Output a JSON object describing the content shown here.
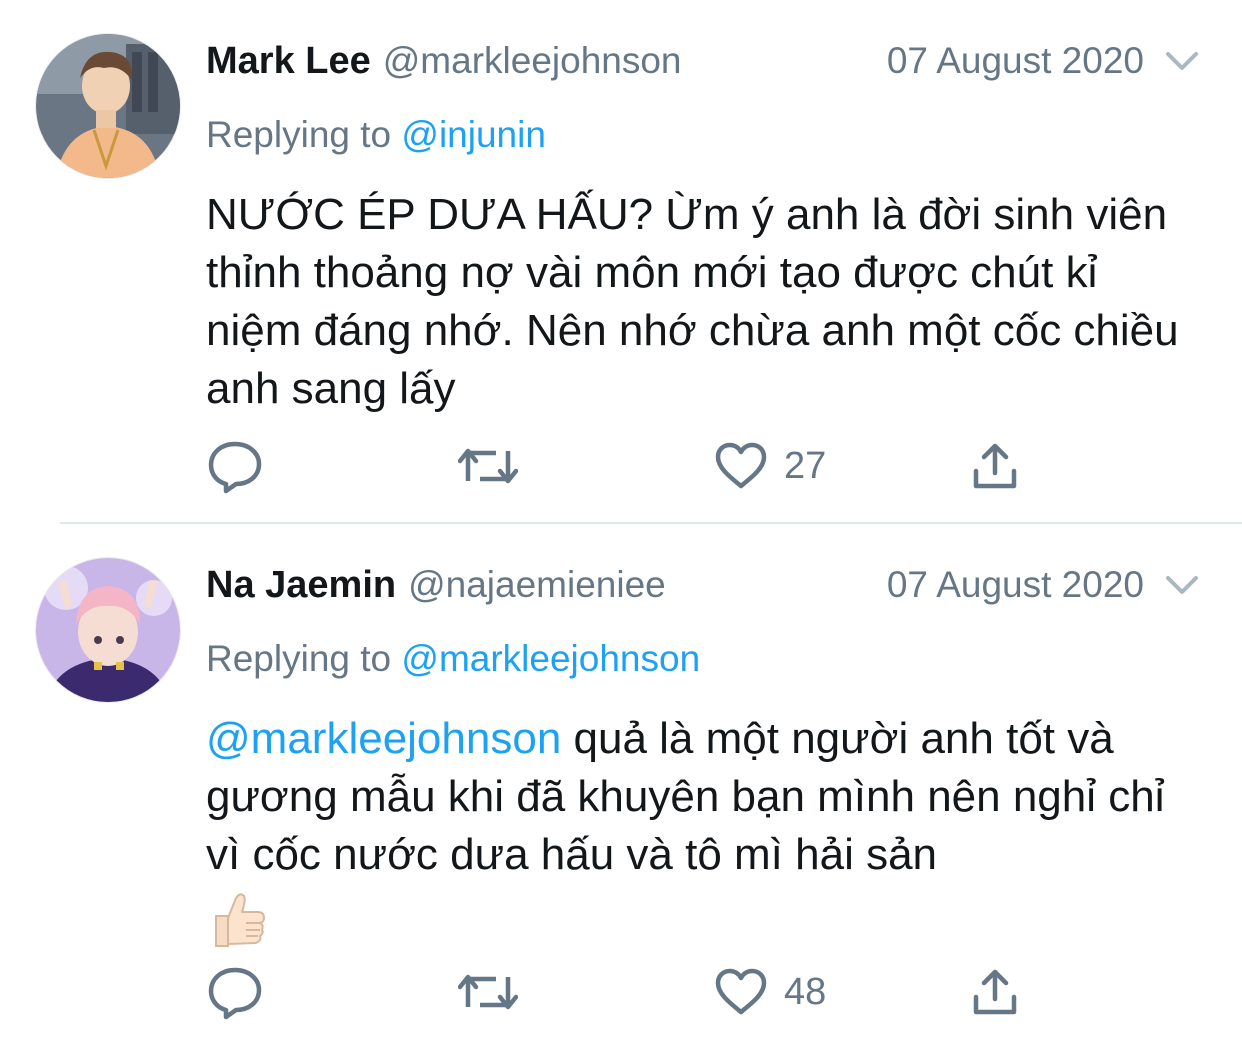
{
  "colors": {
    "link": "#1da1f2",
    "secondary_text": "#657786",
    "primary_text": "#14171a",
    "divider": "#e1e8ed"
  },
  "tweets": [
    {
      "author_name": "Mark Lee",
      "handle": "@markleejohnson",
      "date": "07 August 2020",
      "replying_prefix": "Replying to",
      "replying_to": "@injunin",
      "body": "NƯỚC ÉP DƯA HẤU? Ừm ý anh là đời sinh viên thỉnh thoảng nợ vài môn mới tạo được chút kỉ niệm đáng nhớ. Nên nhớ chừa anh một cốc chiều anh sang lấy",
      "like_count": "27",
      "icons": [
        "reply-icon",
        "retweet-icon",
        "like-icon",
        "share-icon"
      ]
    },
    {
      "author_name": "Na Jaemin",
      "handle": "@najaemieniee",
      "date": "07 August 2020",
      "replying_prefix": "Replying to",
      "replying_to": "@markleejohnson",
      "body_mention": "@markleejohnson",
      "body": " quả là một người anh tốt và gương mẫu khi đã khuyên bạn mình nên nghỉ chỉ vì cốc nước dưa hấu và tô mì hải sản",
      "emoji": "thumbs-up-icon",
      "like_count": "48",
      "icons": [
        "reply-icon",
        "retweet-icon",
        "like-icon",
        "share-icon"
      ]
    }
  ]
}
